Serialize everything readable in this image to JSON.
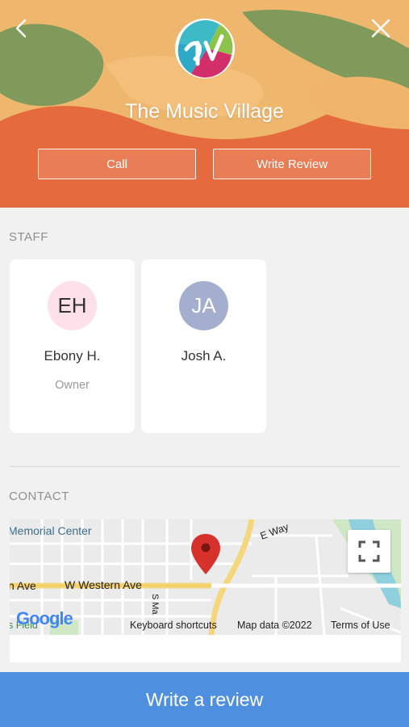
{
  "header": {
    "business_name": "The Music Village",
    "call_label": "Call",
    "write_review_label": "Write Review",
    "back_icon": "chevron-left-icon",
    "close_icon": "close-icon"
  },
  "staff": {
    "section_title": "STAFF",
    "members": [
      {
        "initials": "EH",
        "name": "Ebony H.",
        "role": "Owner"
      },
      {
        "initials": "JA",
        "name": "Josh A.",
        "role": ""
      }
    ]
  },
  "contact": {
    "section_title": "CONTACT",
    "map": {
      "labels": {
        "memorial_center": "Memorial Center",
        "e_way": "E Way",
        "ave_left": "n Ave",
        "w_western_ave": "W Western Ave",
        "s_ma": "S Ma",
        "field": "s Field"
      },
      "google_logo": "Google",
      "keyboard_shortcuts": "Keyboard shortcuts",
      "map_data": "Map data ©2022",
      "terms": "Terms of Use"
    }
  },
  "footer": {
    "write_a_review_label": "Write a review"
  },
  "colors": {
    "accent_blue": "#4f8fe0",
    "hero_orange": "#f0b56b",
    "pin_red": "#d7312c"
  }
}
